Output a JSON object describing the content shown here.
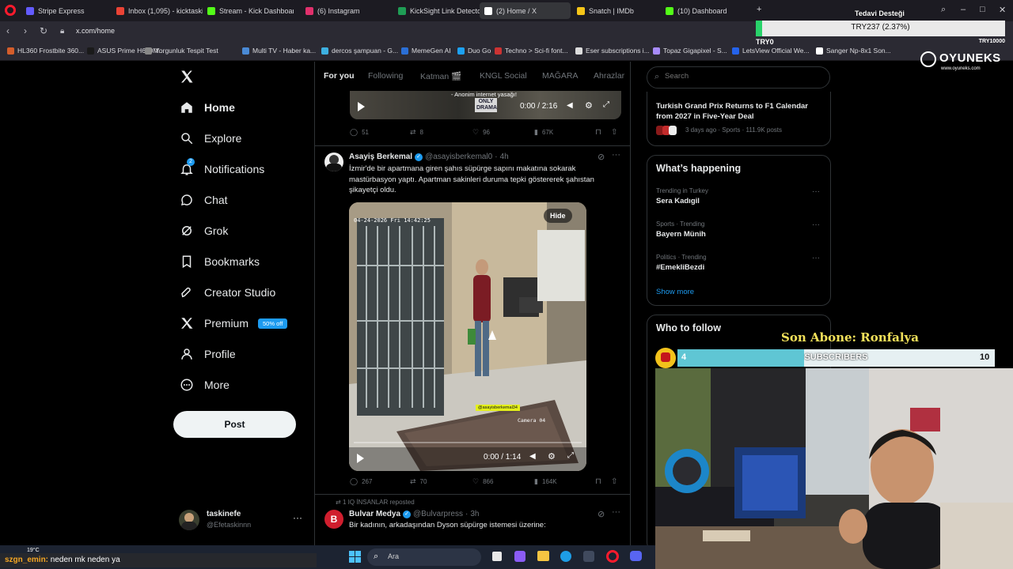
{
  "browser": {
    "tabs": [
      {
        "label": "Stripe Express",
        "color": "#635bff"
      },
      {
        "label": "Inbox (1,095) - kicktaskine",
        "color": "#ea4335"
      },
      {
        "label": "Stream - Kick Dashboard",
        "color": "#53fc18"
      },
      {
        "label": "(6) Instagram",
        "color": "#e1306c"
      },
      {
        "label": "KickSight Link Detector",
        "color": "#1f9d55"
      },
      {
        "label": "(2) Home / X",
        "color": "#ffffff"
      },
      {
        "label": "Snatch | IMDb",
        "color": "#f5c518"
      },
      {
        "label": "(10) Dashboard",
        "color": "#53fc18"
      }
    ],
    "url": "x.com/home",
    "bookmarks": [
      "HL360 Frostbite 360...",
      "ASUS Prime H610M...",
      "Yorgunluk Tespit Test",
      "Multi TV - Haber ka...",
      "dercos şampuan - G...",
      "MemeGen AI",
      "Duo Go",
      "Techno > Sci-fi font...",
      "Eser subscriptions i...",
      "Topaz Gigapixel - S...",
      "LetsView Official We...",
      "Sanger Np-8x1 Son..."
    ]
  },
  "x": {
    "nav": [
      {
        "label": "Home",
        "icon": "home-icon"
      },
      {
        "label": "Explore",
        "icon": "search-icon"
      },
      {
        "label": "Notifications",
        "icon": "bell-icon",
        "badge": "2"
      },
      {
        "label": "Chat",
        "icon": "chat-icon"
      },
      {
        "label": "Grok",
        "icon": "grok-icon"
      },
      {
        "label": "Bookmarks",
        "icon": "bookmark-icon"
      },
      {
        "label": "Creator Studio",
        "icon": "rocket-icon"
      },
      {
        "label": "Premium",
        "icon": "x-logo-icon",
        "badge": "50% off"
      },
      {
        "label": "Profile",
        "icon": "person-icon"
      },
      {
        "label": "More",
        "icon": "more-circle-icon"
      }
    ],
    "post_label": "Post",
    "account": {
      "name": "taskinefe",
      "handle": "@Efetaskinnn"
    },
    "feed_tabs": [
      "For you",
      "Following",
      "Katman 🎬",
      "KNGL Social",
      "MAĞARA",
      "Ahrazlar"
    ],
    "prev_post": {
      "video_caption": "- Anonim internet yasağı!",
      "video_time": "0:00 / 2:16",
      "video_overlay_text": "ONLY DRAMA",
      "replies": "51",
      "reposts": "8",
      "likes": "96",
      "views": "67K"
    },
    "post": {
      "author": "Asayiş Berkemal",
      "handle": "@asayisberkemal0",
      "time": "4h",
      "text": "İzmir'de bir apartmana giren şahıs süpürge sapını makatına sokarak mastürbasyon yaptı. Apartman sakinleri duruma tepki göstererek şahıstan şikayetçi oldu.",
      "hide_label": "Hide",
      "cam_timestamp": "04-24-2026 Fri 14:42:25",
      "cam_label": "Camera 04",
      "watermark": "@asayisberkemal34",
      "video_time": "0:00 / 1:14",
      "replies": "267",
      "reposts": "70",
      "likes": "866",
      "views": "164K"
    },
    "next_post": {
      "repost_note": "1 IQ İNSANLAR reposted",
      "author": "Bulvar Medya",
      "handle": "@Bulvarpress",
      "time": "3h",
      "text": "Bir kadının, arkadaşından Dyson süpürge istemesi üzerine:",
      "avatar_letter": "B"
    },
    "search_placeholder": "Search",
    "news": {
      "title": "Turkish Grand Prix Returns to F1 Calendar from 2027 in Five-Year Deal",
      "meta": "3 days ago · Sports · 111.9K posts"
    },
    "happening_title": "What’s happening",
    "trends": [
      {
        "context": "Trending in Turkey",
        "name": "Sera Kadıgil"
      },
      {
        "context": "Sports · Trending",
        "name": "Bayern Münih"
      },
      {
        "context": "Politics · Trending",
        "name": "#EmekliBezdi"
      }
    ],
    "show_more": "Show more",
    "who_to_follow": "Who to follow"
  },
  "overlay": {
    "ticker_title": "Tedavi Desteği",
    "ticker_value": "TRY237 (2.37%)",
    "ticker_min": "TRY0",
    "ticker_max": "TRY10000",
    "ticker_progress": 0.0237,
    "brand": "OYUNEKS",
    "brand_url": "www.oyuneks.com",
    "last_sub": "Son Abone: Ronfalya",
    "sub_count": "4",
    "sub_label": "SUBSCRIBERS",
    "sub_goal": "10",
    "sub_progress": 0.4
  },
  "taskbar": {
    "weather": "19°C",
    "search": "Ara",
    "chat_user": "szgn_emin:",
    "chat_msg": "neden mk neden ya"
  }
}
